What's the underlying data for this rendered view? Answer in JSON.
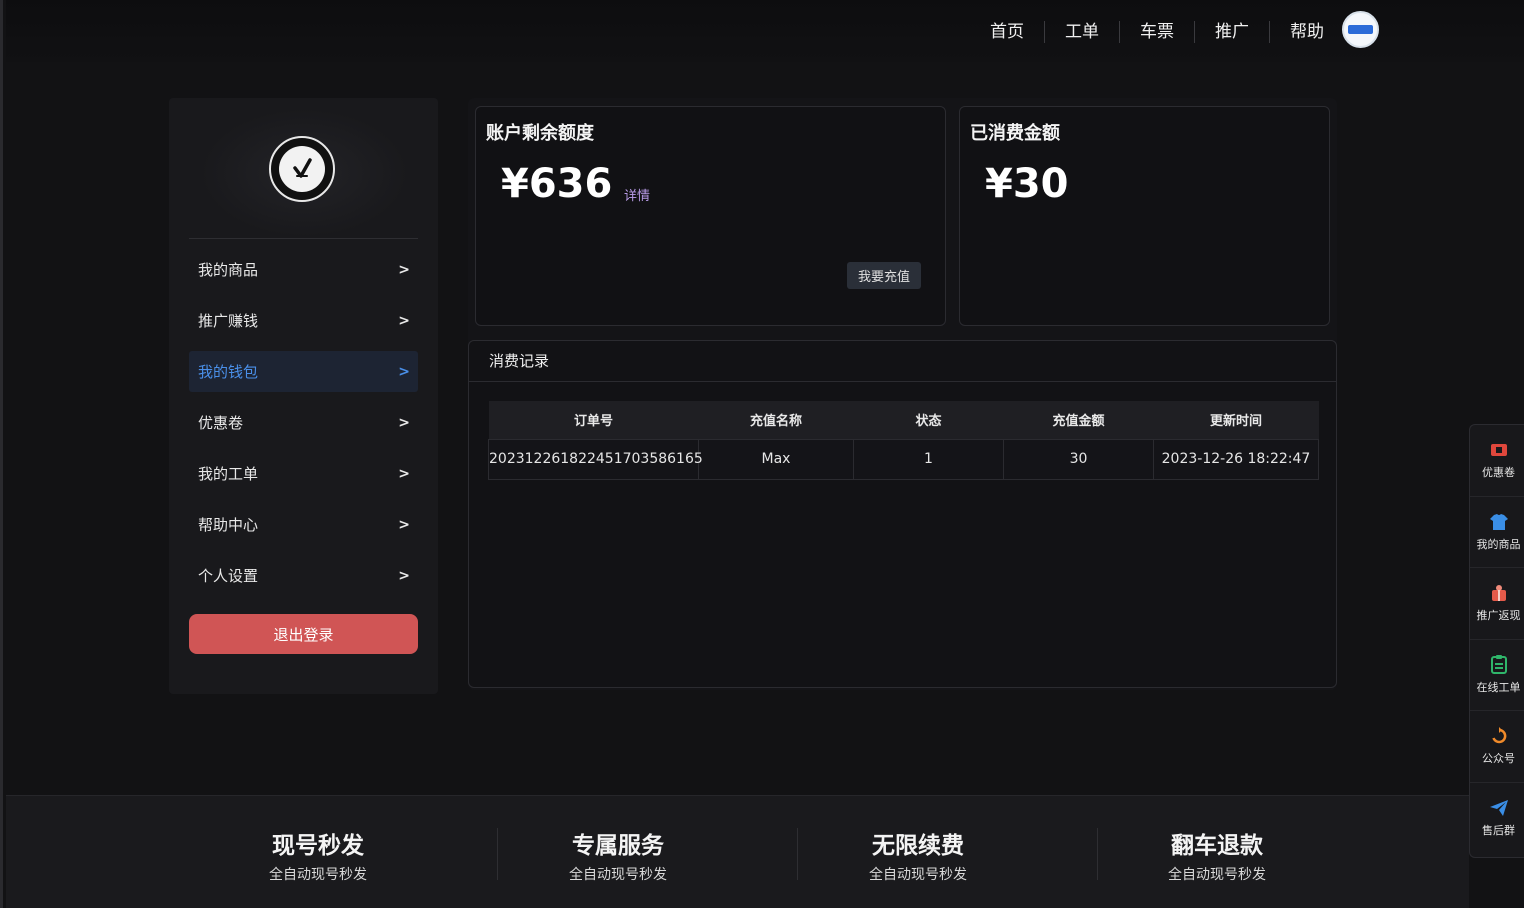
{
  "nav": {
    "items": [
      "首页",
      "工单",
      "车票",
      "推广",
      "帮助"
    ]
  },
  "sidebar": {
    "items": [
      {
        "label": "我的商品",
        "arrow": ">"
      },
      {
        "label": "推广赚钱",
        "arrow": ">"
      },
      {
        "label": "我的钱包",
        "arrow": ">",
        "active": true
      },
      {
        "label": "优惠卷",
        "arrow": ">"
      },
      {
        "label": "我的工单",
        "arrow": ">"
      },
      {
        "label": "帮助中心",
        "arrow": ">"
      },
      {
        "label": "个人设置",
        "arrow": ">"
      }
    ],
    "logout_label": "退出登录"
  },
  "balance_card": {
    "title": "账户剩余额度",
    "amount": "¥636",
    "detail_label": "详情",
    "recharge_label": "我要充值"
  },
  "spent_card": {
    "title": "已消费金额",
    "amount": "¥30"
  },
  "records": {
    "title": "消费记录",
    "columns": [
      "订单号",
      "充值名称",
      "状态",
      "充值金额",
      "更新时间"
    ],
    "rows": [
      [
        "2023122618224517035861​65",
        "Max",
        "1",
        "30",
        "2023-12-26 18:22:47"
      ]
    ]
  },
  "float_bar": {
    "items": [
      {
        "label": "优惠卷",
        "icon": "coupon-icon",
        "color": "#e0473c"
      },
      {
        "label": "我的商品",
        "icon": "shirt-icon",
        "color": "#3a8ee6"
      },
      {
        "label": "推广返现",
        "icon": "gift-icon",
        "color": "#e45a4a"
      },
      {
        "label": "在线工单",
        "icon": "clipboard-icon",
        "color": "#2fb56a"
      },
      {
        "label": "公众号",
        "icon": "refresh-icon",
        "color": "#f08a2a"
      },
      {
        "label": "售后群",
        "icon": "paper-plane-icon",
        "color": "#3a8ee6"
      }
    ]
  },
  "footer": {
    "features": [
      {
        "title": "现号秒发",
        "sub": "全自动现号秒发"
      },
      {
        "title": "专属服务",
        "sub": "全自动现号秒发"
      },
      {
        "title": "无限续费",
        "sub": "全自动现号秒发"
      },
      {
        "title": "翻车退款",
        "sub": "全自动现号秒发"
      }
    ]
  },
  "colors": {
    "accent": "#4a8fe8",
    "logout": "#d05555",
    "detail_link": "#b99ce8"
  }
}
